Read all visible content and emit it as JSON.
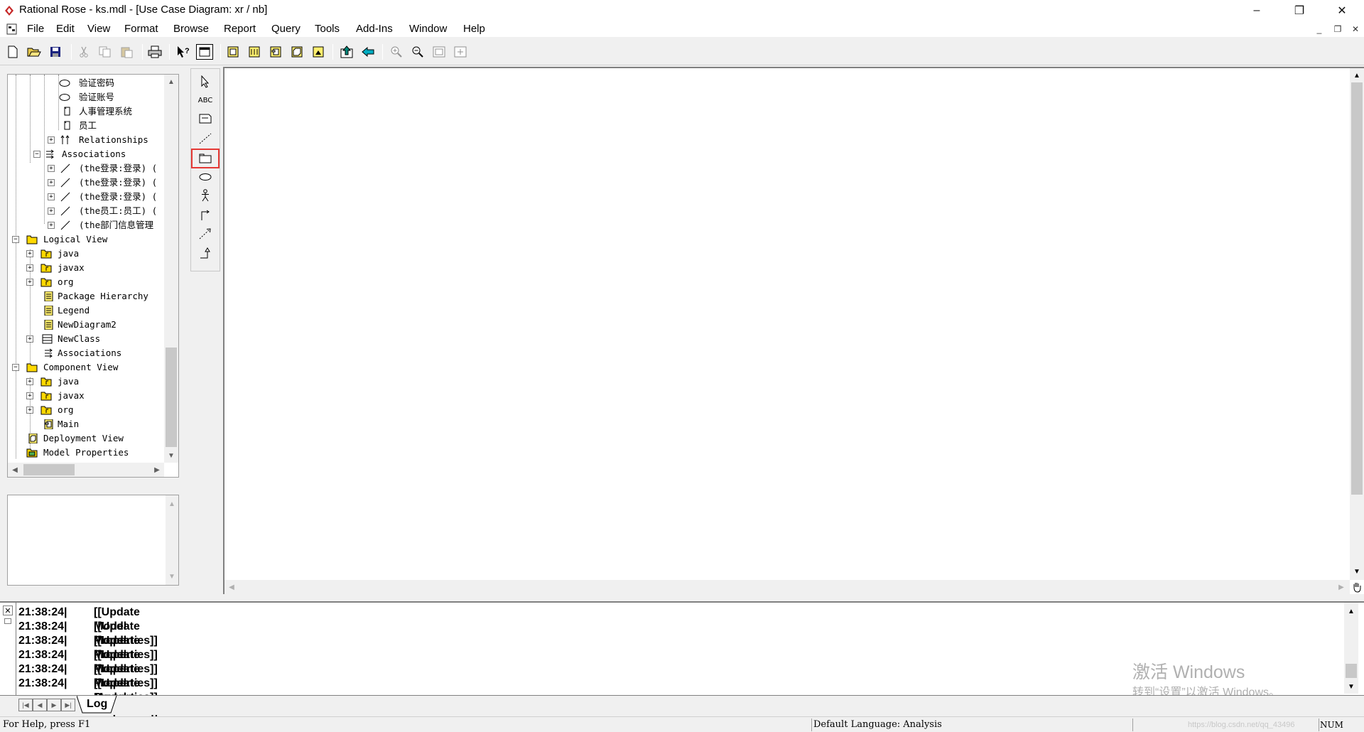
{
  "window": {
    "title": "Rational Rose - ks.mdl - [Use Case Diagram: xr / nb]",
    "controls": {
      "minimize": "–",
      "restore": "❐",
      "close": "✕"
    }
  },
  "menu": {
    "items": [
      "File",
      "Edit",
      "View",
      "Format",
      "Browse",
      "Report",
      "Query",
      "Tools",
      "Add-Ins",
      "Window",
      "Help"
    ],
    "mdi_controls": {
      "minimize": "_",
      "restore": "❐",
      "close": "✕"
    }
  },
  "toolbar": {
    "buttons": [
      "new-icon",
      "open-icon",
      "save-icon",
      "cut-icon",
      "copy-icon",
      "paste-icon",
      "print-icon",
      "context-help-icon",
      "view-doc-icon",
      "browse-class-diagram-icon",
      "browse-interaction-diagram-icon",
      "browse-component-diagram-icon",
      "browse-deployment-diagram-icon",
      "browse-parent-icon",
      "browse-previous-diagram-icon",
      "back-icon",
      "zoom-in-icon",
      "zoom-out-icon",
      "fit-in-window-icon",
      "undo-fit-icon"
    ]
  },
  "tree": {
    "rows": [
      {
        "label": "验证密码",
        "icon": "usecase-icon"
      },
      {
        "label": "验证账号",
        "icon": "usecase-icon"
      },
      {
        "label": "人事管理系统",
        "icon": "actor-icon"
      },
      {
        "label": "员工",
        "icon": "actor-icon"
      },
      {
        "label": "Relationships",
        "icon": "relationships-icon"
      },
      {
        "label": "Associations",
        "icon": "associations-icon"
      },
      {
        "label": "(the登录:登录) (",
        "icon": "association-icon"
      },
      {
        "label": "(the登录:登录) (",
        "icon": "association-icon"
      },
      {
        "label": "(the登录:登录) (",
        "icon": "association-icon"
      },
      {
        "label": "(the员工:员工) (",
        "icon": "association-icon"
      },
      {
        "label": "(the部门信息管理",
        "icon": "association-icon"
      },
      {
        "label": "Logical View",
        "icon": "folder-icon"
      },
      {
        "label": "java",
        "icon": "package-icon"
      },
      {
        "label": "javax",
        "icon": "package-icon"
      },
      {
        "label": "org",
        "icon": "package-icon"
      },
      {
        "label": "Package Hierarchy",
        "icon": "diagram-icon"
      },
      {
        "label": "Legend",
        "icon": "diagram-icon"
      },
      {
        "label": "NewDiagram2",
        "icon": "diagram-icon"
      },
      {
        "label": "NewClass",
        "icon": "class-icon"
      },
      {
        "label": "Associations",
        "icon": "associations-icon"
      },
      {
        "label": "Component View",
        "icon": "folder-icon"
      },
      {
        "label": "java",
        "icon": "package-icon"
      },
      {
        "label": "javax",
        "icon": "package-icon"
      },
      {
        "label": "org",
        "icon": "package-icon"
      },
      {
        "label": "Main",
        "icon": "component-diagram-icon"
      },
      {
        "label": "Deployment View",
        "icon": "deployment-icon"
      },
      {
        "label": "Model Properties",
        "icon": "model-properties-icon"
      }
    ]
  },
  "toolbox": {
    "tools": [
      "selection-arrow-icon",
      "text-box-icon",
      "note-icon",
      "anchor-note-icon",
      "package-tool-icon",
      "use-case-tool-icon",
      "actor-tool-icon",
      "unidirectional-association-icon",
      "dependency-icon",
      "generalization-icon"
    ],
    "abc_label": "ABC"
  },
  "log": {
    "rows": [
      {
        "time": "21:38:24|",
        "msg": "[[Update Model Properties]]"
      },
      {
        "time": "21:38:24|",
        "msg": "[[Update Model Properties]]"
      },
      {
        "time": "21:38:24|",
        "msg": "[[Update Model Properties]]"
      },
      {
        "time": "21:38:24|",
        "msg": "[[Update Model Properties]]"
      },
      {
        "time": "21:38:24|",
        "msg": "[[Update Model Properties]]"
      },
      {
        "time": "21:38:24|",
        "msg": "[[Update Model Properties]]"
      }
    ],
    "tab_label": "Log",
    "close_label": "✕"
  },
  "status": {
    "help": "For Help, press F1",
    "language": "Default Language: Analysis",
    "num": "NUM"
  },
  "watermark": {
    "activate_title": "激活 Windows",
    "activate_sub": "转到“设置”以激活 Windows。",
    "url": "https://blog.csdn.net/qq_43496"
  },
  "colors": {
    "highlight_box": "#e53935",
    "arrow": "#e53935",
    "folder": "#ffd800"
  }
}
